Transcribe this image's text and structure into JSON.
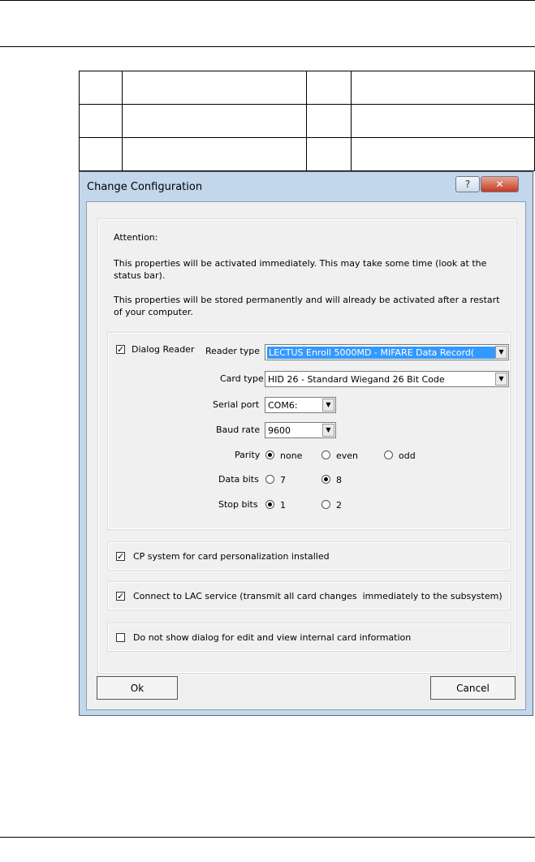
{
  "dialog": {
    "title": "Change Configuration",
    "help_glyph": "?",
    "close_glyph": "✕",
    "attention_heading": "Attention:",
    "attention_line1": "This properties will be activated immediately. This may take some time (look at the status bar).",
    "attention_line2": "This properties will be stored permanently and will already be activated after a restart of your computer.",
    "dialog_reader": {
      "label": "Dialog Reader",
      "checked": true
    },
    "reader_type": {
      "label": "Reader type",
      "value": "LECTUS Enroll 5000MD - MIFARE Data Record("
    },
    "card_type": {
      "label": "Card type",
      "value": "HID 26 - Standard Wiegand 26 Bit Code"
    },
    "serial_port": {
      "label": "Serial port",
      "value": "COM6:"
    },
    "baud_rate": {
      "label": "Baud rate",
      "value": "9600"
    },
    "parity": {
      "label": "Parity",
      "options": [
        "none",
        "even",
        "odd"
      ],
      "selected": "none"
    },
    "data_bits": {
      "label": "Data bits",
      "options": [
        "7",
        "8"
      ],
      "selected": "8"
    },
    "stop_bits": {
      "label": "Stop bits",
      "options": [
        "1",
        "2"
      ],
      "selected": "1"
    },
    "cp_system": {
      "label": "CP system for card personalization installed",
      "checked": true
    },
    "lac_service": {
      "label": "Connect to LAC service (transmit all card changes  immediately to the subsystem)",
      "checked": true
    },
    "no_dialog": {
      "label": "Do not show dialog for edit and view internal card information",
      "checked": false
    },
    "ok_label": "Ok",
    "cancel_label": "Cancel",
    "check_glyph": "✓",
    "arrow_glyph": "▼"
  }
}
